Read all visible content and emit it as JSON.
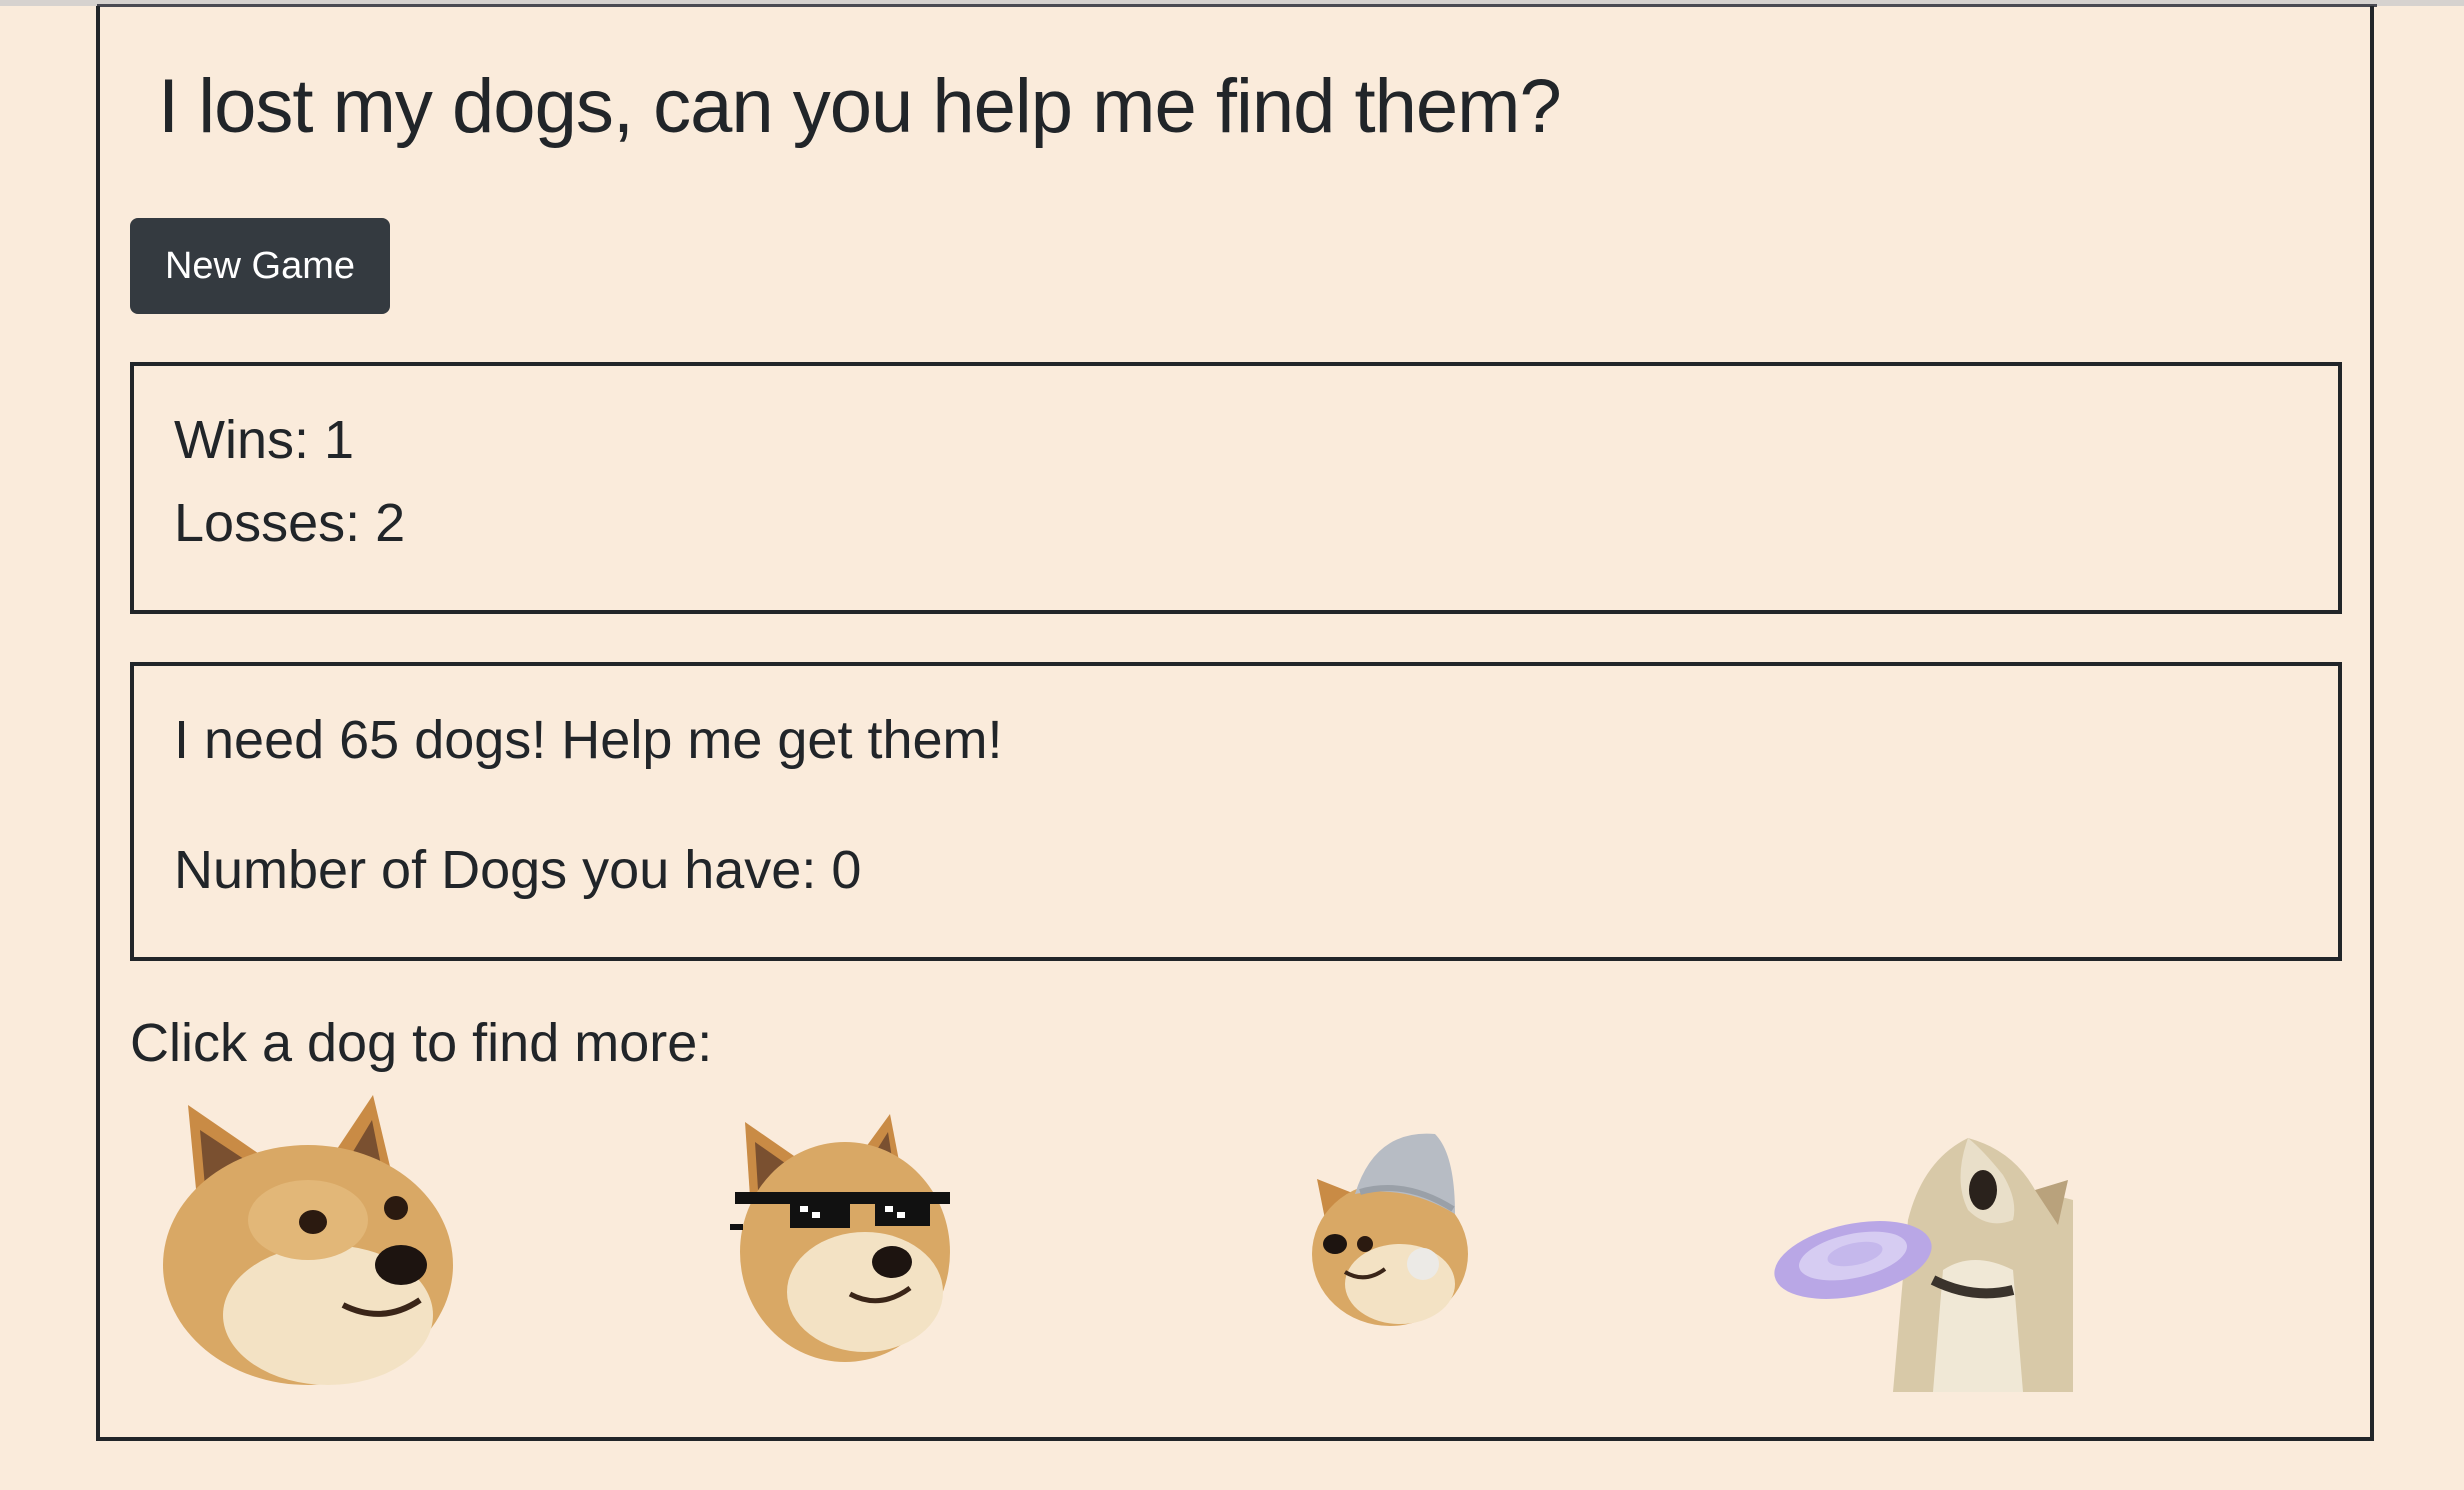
{
  "title": "I lost my dogs, can you help me find them?",
  "new_game_label": "New Game",
  "stats": {
    "wins_label": "Wins: 1",
    "losses_label": "Losses: 2"
  },
  "goal": {
    "target_text": "I need 65 dogs! Help me get them!",
    "count_text": "Number of Dogs you have: 0"
  },
  "prompt": "Click a dog to find more:",
  "dogs": [
    {
      "name": "doge"
    },
    {
      "name": "doge-sunglasses"
    },
    {
      "name": "doge-nightcap"
    },
    {
      "name": "dog-frisbee"
    }
  ],
  "colors": {
    "background": "#faebdb",
    "button": "#343a40",
    "border": "#212529",
    "shiba_fur": "#d9a865",
    "frisbee": "#b9a7e6"
  }
}
